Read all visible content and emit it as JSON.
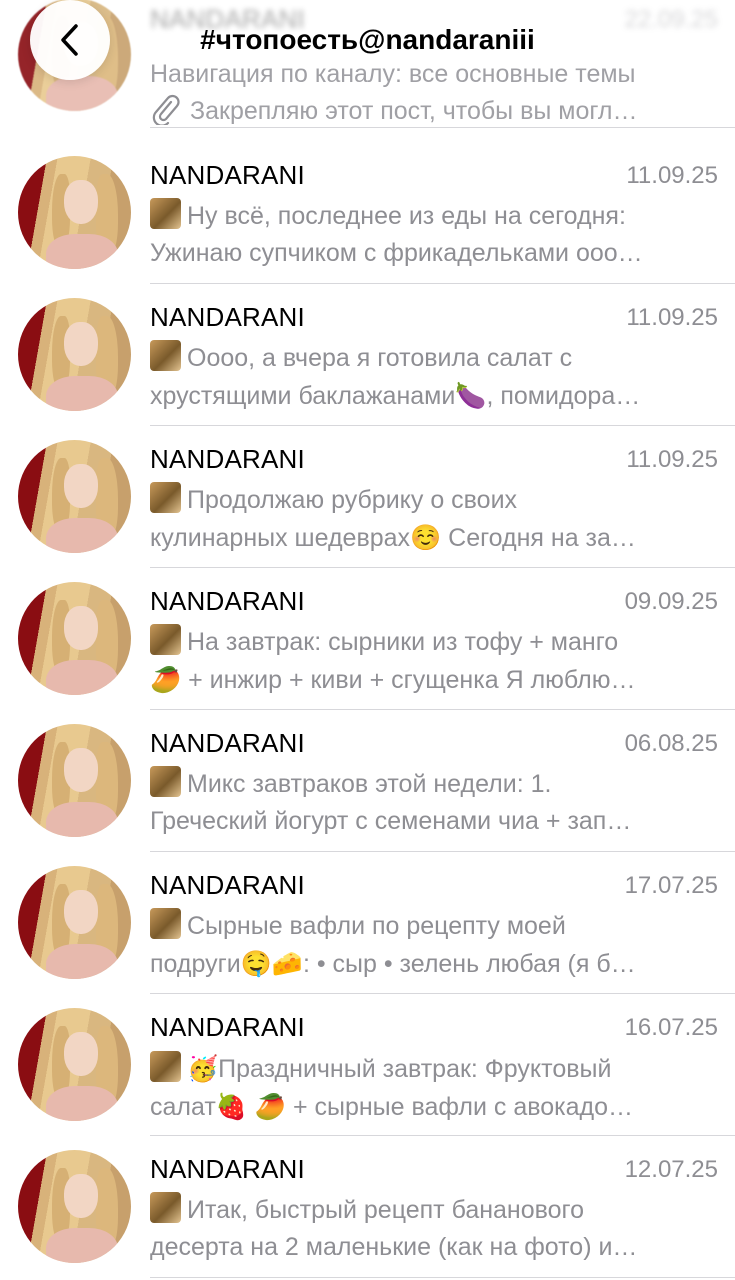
{
  "header": {
    "title": "#чтопоесть@nandaraniii",
    "back_icon": "chevron-left-icon"
  },
  "pinned": {
    "name": "NANDARANI",
    "date": "22.09.25",
    "line1": "Навигация по каналу: все основные темы",
    "line2": "Закрепляю этот пост, чтобы вы могл…",
    "icon": "paperclip-icon"
  },
  "rows": [
    {
      "name": "NANDARANI",
      "date": "11.09.25",
      "line1": "Ну всё, последнее из еды на сегодня:",
      "line2": "Ужинаю супчиком с фрикадельками ооо…"
    },
    {
      "name": "NANDARANI",
      "date": "11.09.25",
      "line1": "Оооо, а вчера я готовила салат с",
      "line2a": "хрустящими баклажанами",
      "emoji2": "🍆",
      "line2b": ", помидора…"
    },
    {
      "name": "NANDARANI",
      "date": "11.09.25",
      "line1": "Продолжаю рубрику о своих",
      "line2a": "кулинарных шедеврах",
      "emoji2": "☺️",
      "line2b": " Сегодня на за…"
    },
    {
      "name": "NANDARANI",
      "date": "09.09.25",
      "line1": "На завтрак: сырники из тофу + манго",
      "emoji2": "🥭",
      "line2b": " + инжир + киви + сгущенка Я люблю…"
    },
    {
      "name": "NANDARANI",
      "date": "06.08.25",
      "line1": "Микс завтраков этой недели: 1.",
      "line2": "Греческий йогурт с семенами чиа + зап…"
    },
    {
      "name": "NANDARANI",
      "date": "17.07.25",
      "line1": "Сырные вафли по рецепту моей",
      "line2a": "подруги",
      "emoji2": "🤤🧀",
      "line2b": ": • сыр • зелень любая (я б…"
    },
    {
      "name": "NANDARANI",
      "date": "16.07.25",
      "emoji1": "🥳",
      "line1": "Праздничный завтрак: Фруктовый",
      "line2a": "салат",
      "emoji2": "🍓 🥭",
      "line2b": " + сырные вафли с авокадо…"
    },
    {
      "name": "NANDARANI",
      "date": "12.07.25",
      "line1": "Итак, быстрый рецепт бананового",
      "line2": "десерта на 2 маленькие (как на фото) и…"
    }
  ]
}
